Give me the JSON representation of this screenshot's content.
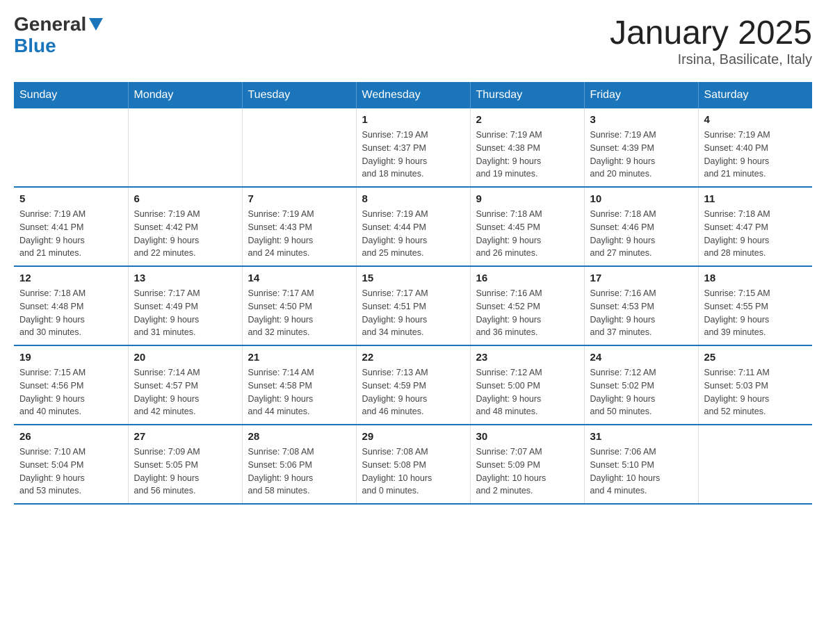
{
  "header": {
    "logo_general": "General",
    "logo_blue": "Blue",
    "title": "January 2025",
    "subtitle": "Irsina, Basilicate, Italy"
  },
  "days_of_week": [
    "Sunday",
    "Monday",
    "Tuesday",
    "Wednesday",
    "Thursday",
    "Friday",
    "Saturday"
  ],
  "weeks": [
    [
      {
        "day": "",
        "info": ""
      },
      {
        "day": "",
        "info": ""
      },
      {
        "day": "",
        "info": ""
      },
      {
        "day": "1",
        "info": "Sunrise: 7:19 AM\nSunset: 4:37 PM\nDaylight: 9 hours\nand 18 minutes."
      },
      {
        "day": "2",
        "info": "Sunrise: 7:19 AM\nSunset: 4:38 PM\nDaylight: 9 hours\nand 19 minutes."
      },
      {
        "day": "3",
        "info": "Sunrise: 7:19 AM\nSunset: 4:39 PM\nDaylight: 9 hours\nand 20 minutes."
      },
      {
        "day": "4",
        "info": "Sunrise: 7:19 AM\nSunset: 4:40 PM\nDaylight: 9 hours\nand 21 minutes."
      }
    ],
    [
      {
        "day": "5",
        "info": "Sunrise: 7:19 AM\nSunset: 4:41 PM\nDaylight: 9 hours\nand 21 minutes."
      },
      {
        "day": "6",
        "info": "Sunrise: 7:19 AM\nSunset: 4:42 PM\nDaylight: 9 hours\nand 22 minutes."
      },
      {
        "day": "7",
        "info": "Sunrise: 7:19 AM\nSunset: 4:43 PM\nDaylight: 9 hours\nand 24 minutes."
      },
      {
        "day": "8",
        "info": "Sunrise: 7:19 AM\nSunset: 4:44 PM\nDaylight: 9 hours\nand 25 minutes."
      },
      {
        "day": "9",
        "info": "Sunrise: 7:18 AM\nSunset: 4:45 PM\nDaylight: 9 hours\nand 26 minutes."
      },
      {
        "day": "10",
        "info": "Sunrise: 7:18 AM\nSunset: 4:46 PM\nDaylight: 9 hours\nand 27 minutes."
      },
      {
        "day": "11",
        "info": "Sunrise: 7:18 AM\nSunset: 4:47 PM\nDaylight: 9 hours\nand 28 minutes."
      }
    ],
    [
      {
        "day": "12",
        "info": "Sunrise: 7:18 AM\nSunset: 4:48 PM\nDaylight: 9 hours\nand 30 minutes."
      },
      {
        "day": "13",
        "info": "Sunrise: 7:17 AM\nSunset: 4:49 PM\nDaylight: 9 hours\nand 31 minutes."
      },
      {
        "day": "14",
        "info": "Sunrise: 7:17 AM\nSunset: 4:50 PM\nDaylight: 9 hours\nand 32 minutes."
      },
      {
        "day": "15",
        "info": "Sunrise: 7:17 AM\nSunset: 4:51 PM\nDaylight: 9 hours\nand 34 minutes."
      },
      {
        "day": "16",
        "info": "Sunrise: 7:16 AM\nSunset: 4:52 PM\nDaylight: 9 hours\nand 36 minutes."
      },
      {
        "day": "17",
        "info": "Sunrise: 7:16 AM\nSunset: 4:53 PM\nDaylight: 9 hours\nand 37 minutes."
      },
      {
        "day": "18",
        "info": "Sunrise: 7:15 AM\nSunset: 4:55 PM\nDaylight: 9 hours\nand 39 minutes."
      }
    ],
    [
      {
        "day": "19",
        "info": "Sunrise: 7:15 AM\nSunset: 4:56 PM\nDaylight: 9 hours\nand 40 minutes."
      },
      {
        "day": "20",
        "info": "Sunrise: 7:14 AM\nSunset: 4:57 PM\nDaylight: 9 hours\nand 42 minutes."
      },
      {
        "day": "21",
        "info": "Sunrise: 7:14 AM\nSunset: 4:58 PM\nDaylight: 9 hours\nand 44 minutes."
      },
      {
        "day": "22",
        "info": "Sunrise: 7:13 AM\nSunset: 4:59 PM\nDaylight: 9 hours\nand 46 minutes."
      },
      {
        "day": "23",
        "info": "Sunrise: 7:12 AM\nSunset: 5:00 PM\nDaylight: 9 hours\nand 48 minutes."
      },
      {
        "day": "24",
        "info": "Sunrise: 7:12 AM\nSunset: 5:02 PM\nDaylight: 9 hours\nand 50 minutes."
      },
      {
        "day": "25",
        "info": "Sunrise: 7:11 AM\nSunset: 5:03 PM\nDaylight: 9 hours\nand 52 minutes."
      }
    ],
    [
      {
        "day": "26",
        "info": "Sunrise: 7:10 AM\nSunset: 5:04 PM\nDaylight: 9 hours\nand 53 minutes."
      },
      {
        "day": "27",
        "info": "Sunrise: 7:09 AM\nSunset: 5:05 PM\nDaylight: 9 hours\nand 56 minutes."
      },
      {
        "day": "28",
        "info": "Sunrise: 7:08 AM\nSunset: 5:06 PM\nDaylight: 9 hours\nand 58 minutes."
      },
      {
        "day": "29",
        "info": "Sunrise: 7:08 AM\nSunset: 5:08 PM\nDaylight: 10 hours\nand 0 minutes."
      },
      {
        "day": "30",
        "info": "Sunrise: 7:07 AM\nSunset: 5:09 PM\nDaylight: 10 hours\nand 2 minutes."
      },
      {
        "day": "31",
        "info": "Sunrise: 7:06 AM\nSunset: 5:10 PM\nDaylight: 10 hours\nand 4 minutes."
      },
      {
        "day": "",
        "info": ""
      }
    ]
  ]
}
